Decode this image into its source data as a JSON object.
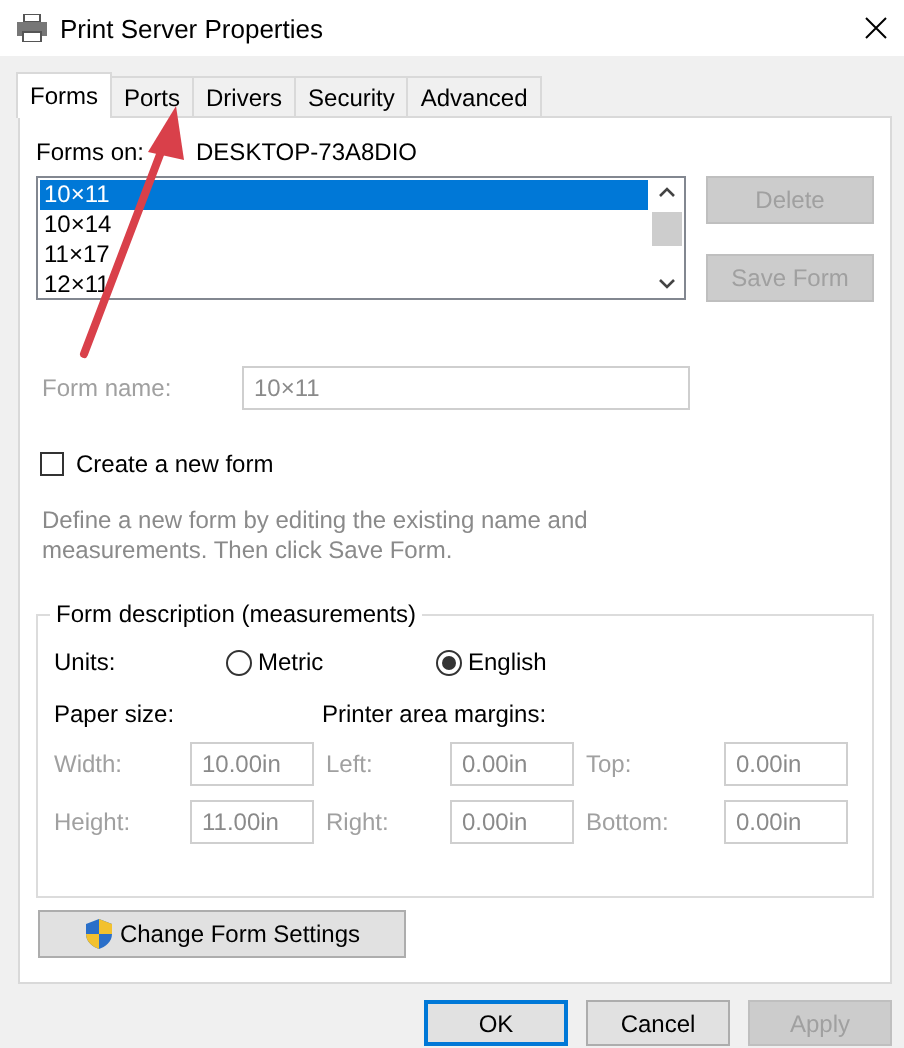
{
  "window": {
    "title": "Print Server Properties"
  },
  "tabs": [
    {
      "label": "Forms",
      "selected": true
    },
    {
      "label": "Ports",
      "selected": false
    },
    {
      "label": "Drivers",
      "selected": false
    },
    {
      "label": "Security",
      "selected": false
    },
    {
      "label": "Advanced",
      "selected": false
    }
  ],
  "forms_on": {
    "label": "Forms on:",
    "value": "DESKTOP-73A8DIO"
  },
  "forms_list": [
    {
      "label": "10×11",
      "selected": true
    },
    {
      "label": "10×14",
      "selected": false
    },
    {
      "label": "11×17",
      "selected": false
    },
    {
      "label": "12×11",
      "selected": false
    }
  ],
  "side_buttons": [
    {
      "label": "Delete",
      "disabled": true
    },
    {
      "label": "Save Form",
      "disabled": true
    }
  ],
  "form_name": {
    "label": "Form name:",
    "value": "10×11",
    "disabled": true
  },
  "create_new_form": {
    "label": "Create a new form",
    "checked": false
  },
  "hint": "Define a new form by editing the existing name and measurements. Then click Save Form.",
  "form_description": {
    "title": "Form description (measurements)",
    "units_label": "Units:",
    "units": [
      {
        "label": "Metric",
        "selected": false
      },
      {
        "label": "English",
        "selected": true
      }
    ],
    "paper_size_label": "Paper size:",
    "margins_label": "Printer area margins:",
    "fields": [
      {
        "label": "Width:",
        "value": "10.00in",
        "disabled": true
      },
      {
        "label": "Left:",
        "value": "0.00in",
        "disabled": true
      },
      {
        "label": "Top:",
        "value": "0.00in",
        "disabled": true
      },
      {
        "label": "Height:",
        "value": "11.00in",
        "disabled": true
      },
      {
        "label": "Right:",
        "value": "0.00in",
        "disabled": true
      },
      {
        "label": "Bottom:",
        "value": "0.00in",
        "disabled": true
      }
    ]
  },
  "change_button": {
    "label": "Change Form Settings"
  },
  "buttons": [
    {
      "label": "OK",
      "default": true,
      "disabled": false
    },
    {
      "label": "Cancel",
      "default": false,
      "disabled": false
    },
    {
      "label": "Apply",
      "default": false,
      "disabled": true
    }
  ]
}
